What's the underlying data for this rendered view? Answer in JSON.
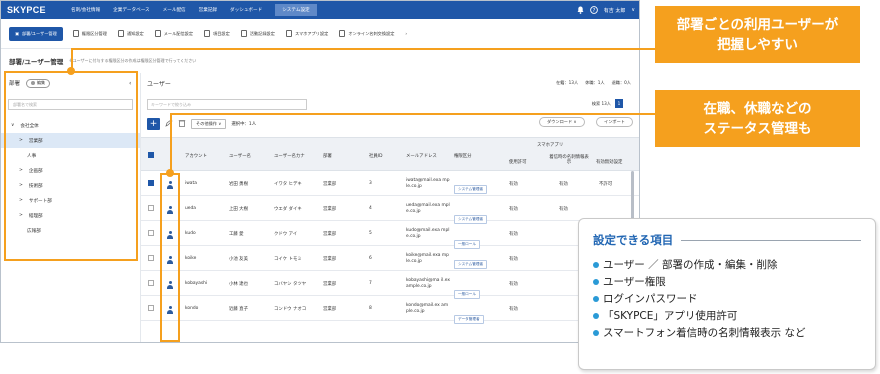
{
  "app": {
    "brand": "SKYPCE",
    "nav": [
      "名刺/会社情報",
      "企業データベース",
      "メール配信",
      "営業記録",
      "ダッシュボード",
      "システム設定"
    ],
    "nav_active": 5,
    "user": "有吉 太郎"
  },
  "subnav": {
    "items": [
      "部署/ユーザー管理",
      "権限区分管理",
      "通知設定",
      "メール配信設定",
      "項目設定",
      "活動記録設定",
      "スマホアプリ設定",
      "オンライン名刺交換設定"
    ],
    "active": 0
  },
  "page": {
    "title": "部署/ユーザー管理",
    "subtitle": "※ユーザーに付与する権限区分の作成は権限区分管理で行ってください"
  },
  "sidebar": {
    "title": "部署",
    "toggle": "編集",
    "search_placeholder": "部署名で検索",
    "tree": [
      {
        "label": "会社全体",
        "expand": "∨",
        "indent": 10
      },
      {
        "label": "営業部",
        "expand": ">",
        "indent": 18,
        "selected": true
      },
      {
        "label": "人事",
        "expand": "",
        "indent": 26
      },
      {
        "label": "企画部",
        "expand": ">",
        "indent": 18
      },
      {
        "label": "技術部",
        "expand": ">",
        "indent": 18
      },
      {
        "label": "サポート部",
        "expand": ">",
        "indent": 18
      },
      {
        "label": "経理部",
        "expand": ">",
        "indent": 18
      },
      {
        "label": "広報部",
        "expand": "",
        "indent": 26
      }
    ]
  },
  "main": {
    "title": "ユーザー",
    "counts": [
      "在籍：13人",
      "休職：1人",
      "退職：0人"
    ],
    "search_placeholder": "キーワードで絞り込み",
    "pager": "検索 13人",
    "page": "1",
    "actions": {
      "ops": "その他操作",
      "selected": "選択中：1人",
      "download": "ダウンロード",
      "import": "インポート"
    }
  },
  "table": {
    "headers": {
      "account": "アカウント",
      "name": "ユーザー名",
      "kana": "ユーザー名カナ",
      "dept": "部署",
      "empno": "社員ID",
      "email": "メールアドレス",
      "role": "権限区分",
      "app_group": "スマホアプリ",
      "use": "使用許可",
      "card": "着信時の名刺情報表示",
      "status": "有効無効設定"
    },
    "rows": [
      {
        "account": "iwata",
        "name": "岩田 勇樹",
        "kana": "イワタ ヒデキ",
        "dept": "営業部",
        "id": "3",
        "email": "iwata@mail.exa mple.co.jp",
        "roles": [
          "一般ロール",
          "システム管理者"
        ],
        "use": "有効",
        "card": "有効",
        "status": "不許可",
        "checked": true
      },
      {
        "account": "ueda",
        "name": "上田 大樹",
        "kana": "ウエダ ダイキ",
        "dept": "営業部",
        "id": "4",
        "email": "ueda@mail.exa mple.co.jp",
        "roles": [
          "システム管理者"
        ],
        "use": "有効",
        "card": "有効",
        "status": "",
        "checked": false
      },
      {
        "account": "kudo",
        "name": "工藤 愛",
        "kana": "クドウ アイ",
        "dept": "営業部",
        "id": "5",
        "email": "kudo@mail.exa mple.co.jp",
        "roles": [
          "一般ロール"
        ],
        "use": "有効",
        "card": "",
        "status": "",
        "checked": false
      },
      {
        "account": "koike",
        "name": "小池 友美",
        "kana": "コイケ トモミ",
        "dept": "営業部",
        "id": "6",
        "email": "koike@mail.exa mple.co.jp",
        "roles": [
          "一般ロール",
          "システム管理者"
        ],
        "use": "有効",
        "card": "",
        "status": "",
        "checked": false
      },
      {
        "account": "kobayashi",
        "name": "小林 達也",
        "kana": "コバヤシ タツヤ",
        "dept": "営業部",
        "id": "7",
        "email": "kobayashi@ma il.example.co.jp",
        "roles": [
          "一般ロール"
        ],
        "use": "有効",
        "card": "",
        "status": "",
        "checked": false
      },
      {
        "account": "kondo",
        "name": "近藤 直子",
        "kana": "コンドウ ナオコ",
        "dept": "営業部",
        "id": "8",
        "email": "kondo@mail.ex ample.co.jp",
        "roles": [
          "データ管理者"
        ],
        "use": "有効",
        "card": "",
        "status": "",
        "checked": false
      }
    ]
  },
  "callouts": {
    "dept_users": [
      "部署ごとの利用ユーザーが",
      "把握しやすい"
    ],
    "status": [
      "在職、休職などの",
      "ステータス管理も"
    ]
  },
  "card": {
    "title": "設定できる項目",
    "items": [
      "ユーザー ／ 部署の作成・編集・削除",
      "ユーザー権限",
      "ログインパスワード",
      "「SKYPCE」アプリ使用許可",
      "スマートフォン着信時の名刺情報表示 など"
    ]
  },
  "colors": {
    "brand": "#1f57a8",
    "accent": "#f5a01e",
    "card_title": "#2166b3"
  }
}
